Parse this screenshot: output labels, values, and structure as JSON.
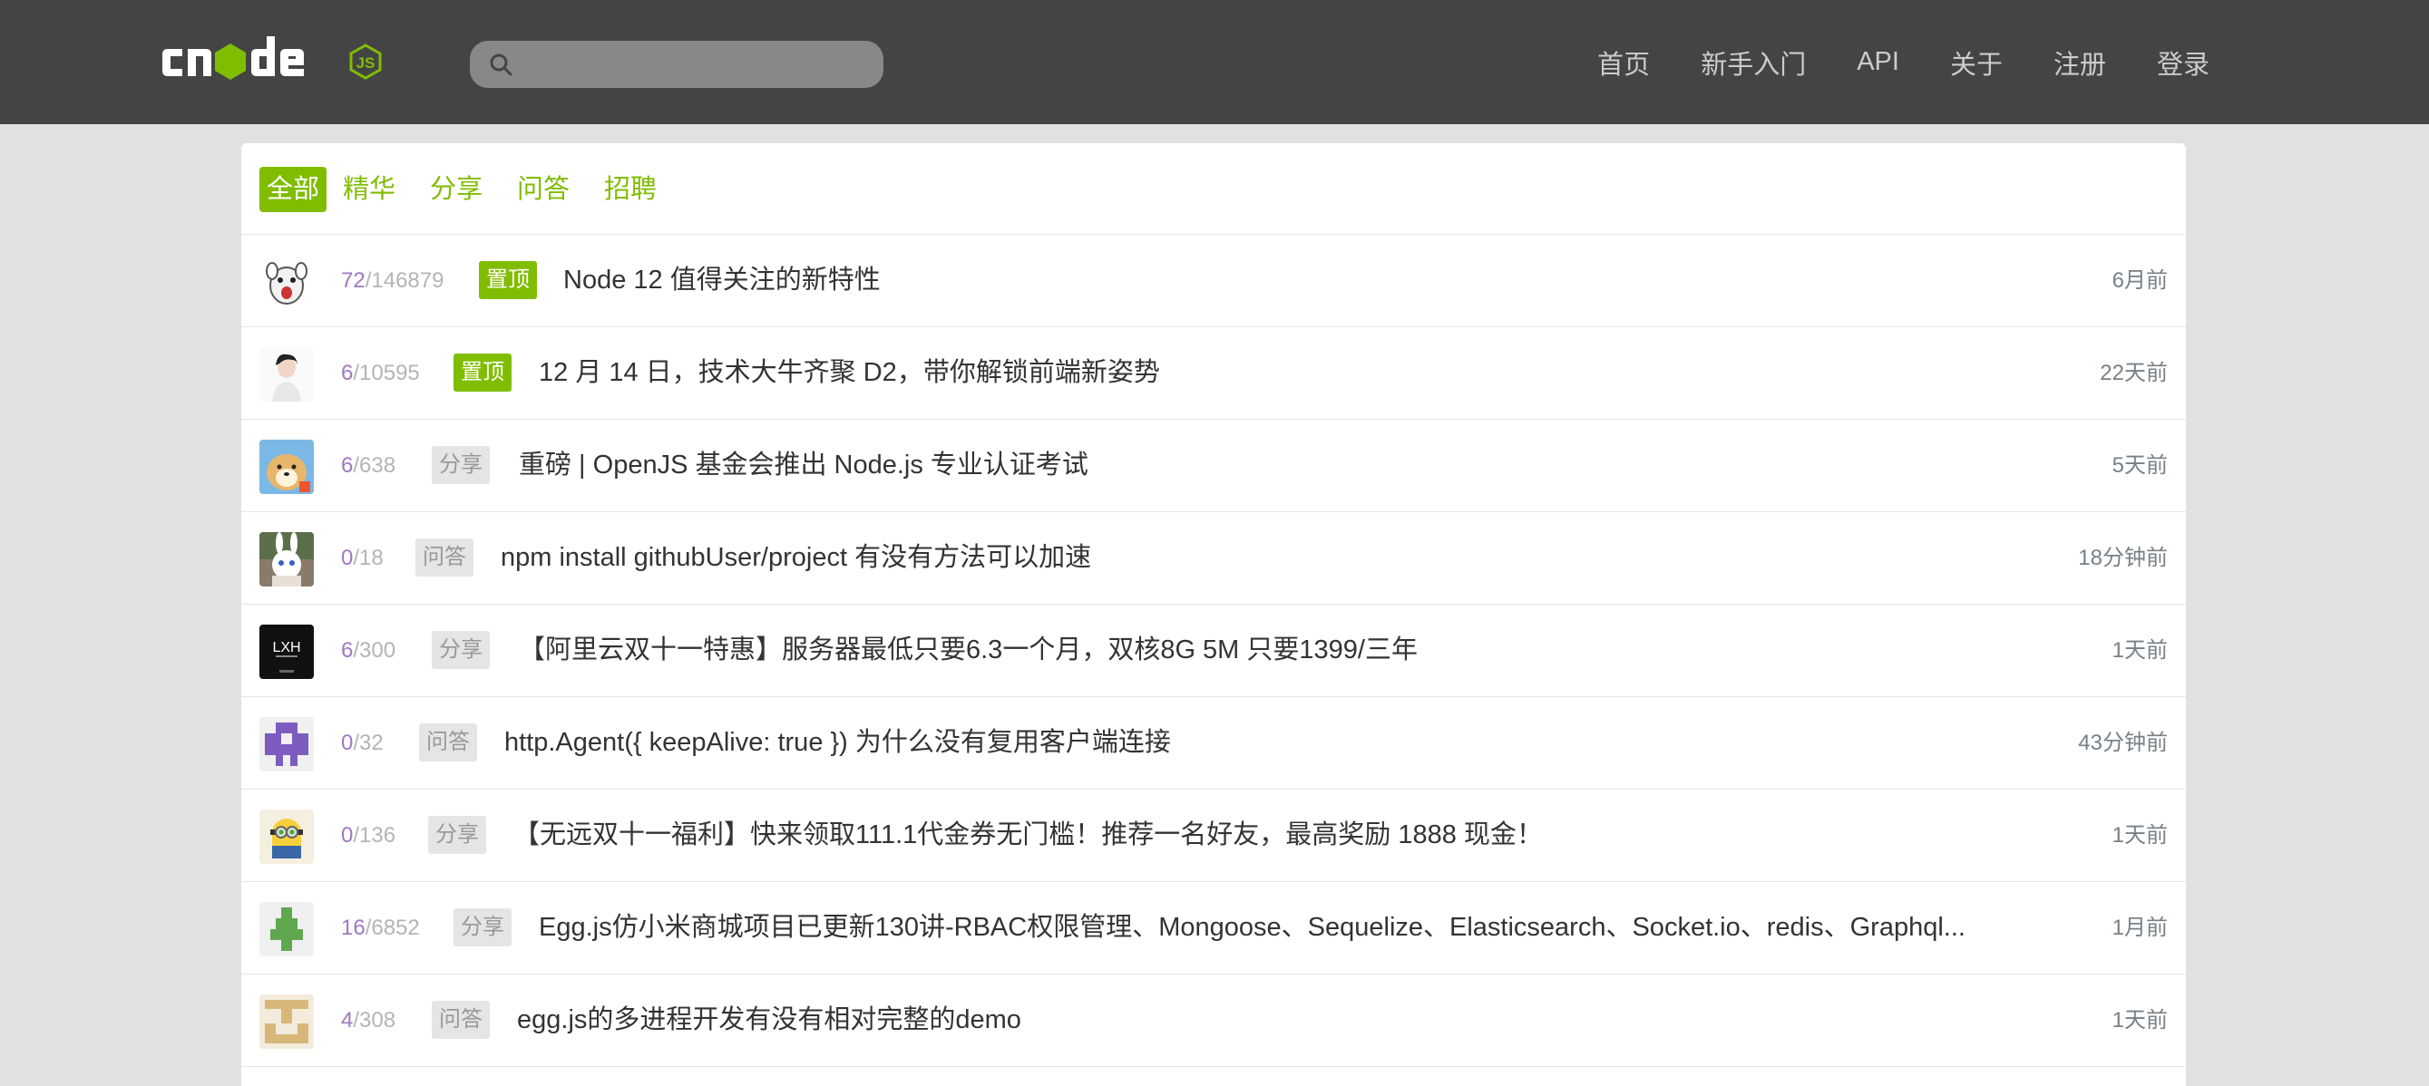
{
  "nav": {
    "search_placeholder": "",
    "links": [
      "首页",
      "新手入门",
      "API",
      "关于",
      "注册",
      "登录"
    ]
  },
  "tabs": [
    "全部",
    "精华",
    "分享",
    "问答",
    "招聘"
  ],
  "active_tab": "全部",
  "topics": [
    {
      "replies": "72",
      "sep": "/",
      "views": "146879",
      "badge": "置顶",
      "badge_type": "top",
      "title": "Node 12 值得关注的新特性",
      "time": "6月前",
      "avatar": "cartoon-dog-avatar"
    },
    {
      "replies": "6",
      "sep": "/",
      "views": "10595",
      "badge": "置顶",
      "badge_type": "top",
      "title": "12 月 14 日，技术大牛齐聚 D2，带你解锁前端新姿势",
      "time": "22天前",
      "avatar": "woman-portrait-avatar"
    },
    {
      "replies": "6",
      "sep": "/",
      "views": "638",
      "badge": "分享",
      "badge_type": "normal",
      "title": "重磅 | OpenJS 基金会推出 Node.js 专业认证考试",
      "time": "5天前",
      "avatar": "dog-photo-avatar"
    },
    {
      "replies": "0",
      "sep": "/",
      "views": "18",
      "badge": "问答",
      "badge_type": "normal",
      "title": "npm install githubUser/project 有没有方法可以加速",
      "time": "18分钟前",
      "avatar": "bunny-photo-avatar"
    },
    {
      "replies": "6",
      "sep": "/",
      "views": "300",
      "badge": "分享",
      "badge_type": "normal",
      "title": "【阿里云双十一特惠】服务器最低只要6.3一个月，双核8G 5M 只要1399/三年",
      "time": "1天前",
      "avatar": "lxh-logo-avatar",
      "avatar_text": "LXH"
    },
    {
      "replies": "0",
      "sep": "/",
      "views": "32",
      "badge": "问答",
      "badge_type": "normal",
      "title": "http.Agent({ keepAlive: true }) 为什么没有复用客户端连接",
      "time": "43分钟前",
      "avatar": "purple-identicon-avatar"
    },
    {
      "replies": "0",
      "sep": "/",
      "views": "136",
      "badge": "分享",
      "badge_type": "normal",
      "title": "【无远双十一福利】快来领取111.1代金券无门槛！推荐一名好友，最高奖励 1888 现金！",
      "time": "1天前",
      "avatar": "minion-avatar"
    },
    {
      "replies": "16",
      "sep": "/",
      "views": "6852",
      "badge": "分享",
      "badge_type": "normal",
      "title": "Egg.js仿小米商城项目已更新130讲-RBAC权限管理、Mongoose、Sequelize、Elasticsearch、Socket.io、redis、Graphql...",
      "time": "1月前",
      "avatar": "green-identicon-avatar"
    },
    {
      "replies": "4",
      "sep": "/",
      "views": "308",
      "badge": "问答",
      "badge_type": "normal",
      "title": "egg.js的多进程开发有没有相对完整的demo",
      "time": "1天前",
      "avatar": "tan-identicon-avatar"
    }
  ],
  "colors": {
    "brand_green": "#80bd01",
    "navbar": "#444444",
    "reply_count": "#9e78c0"
  }
}
